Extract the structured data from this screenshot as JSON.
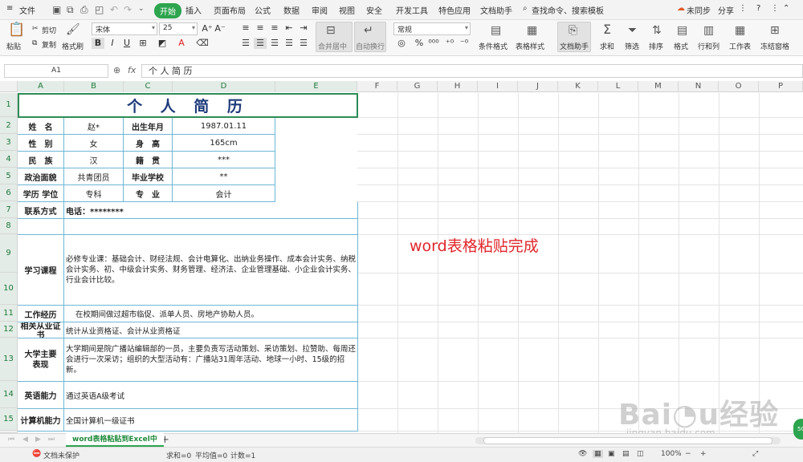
{
  "menu": {
    "file": "文件",
    "start": "开始",
    "tabs": [
      "插入",
      "页面布局",
      "公式",
      "数据",
      "审阅",
      "视图",
      "安全",
      "开发工具",
      "特色应用",
      "文档助手"
    ],
    "search": "查找命令、搜索模板",
    "sync": "未同步",
    "share": "分享"
  },
  "toolbar": {
    "paste": "粘贴",
    "cut": "剪切",
    "copy": "复制",
    "format_painter": "格式刷",
    "font": "宋体",
    "size": "25",
    "merge": "合并居中",
    "wrap": "自动换行",
    "number_format": "常规",
    "cond_format": "条件格式",
    "table_style": "表格样式",
    "doc_helper": "文档助手",
    "sum": "求和",
    "filter": "筛选",
    "sort": "排序",
    "format": "格式",
    "row_col": "行和列",
    "worksheet": "工作表",
    "freeze": "冻结窗格"
  },
  "formula": {
    "cell_ref": "A1",
    "fx": "fx",
    "content": "个 人 简 历"
  },
  "columns": [
    "A",
    "B",
    "C",
    "D",
    "E",
    "F",
    "G",
    "H",
    "I",
    "J",
    "K",
    "L",
    "M",
    "N",
    "O",
    "P"
  ],
  "rows": [
    "1",
    "2",
    "3",
    "4",
    "5",
    "6",
    "7",
    "8",
    "9",
    "10",
    "11",
    "12",
    "13",
    "14",
    "15"
  ],
  "resume": {
    "title": "个 人 简 历",
    "name_label": "姓　名",
    "name": "赵*",
    "birth_label": "出生年月",
    "birth": "1987.01.11",
    "gender_label": "性　别",
    "gender": "女",
    "height_label": "身　高",
    "height": "165cm",
    "ethnic_label": "民　族",
    "ethnic": "汉",
    "native_label": "籍　贯",
    "native": "***",
    "political_label": "政治面貌",
    "political": "共青团员",
    "school_label": "毕业学校",
    "school": "**",
    "degree_label": "学历 学位",
    "degree": "专科",
    "major_label": "专　业",
    "major": "会计",
    "contact_label": "联系方式",
    "contact": "电话：********",
    "course_label": "学习课程",
    "course": "必修专业课：基础会计、财经法规、会计电算化、出纳业务操作、成本会计实务、纳税会计实务、初、中级会计实务、财务管理、经济法、企业管理基础、小企业会计实务、行业会计比较。",
    "work_label": "工作经历",
    "work": "在校期间做过超市临促、派单人员、房地产协助人员。",
    "cert_label": "相关从业证书",
    "cert": "统计从业资格证、会计从业资格证",
    "college_label": "大学主要表现",
    "college": "大学期间是院广播站编辑部的一员，主要负责写活动策划、采访策划、拉赞助、每周还会进行一次采访；组织的大型活动有：广播站31周年活动、地球一小时、15级的招新。",
    "english_label": "英语能力",
    "english": "通过英语A级考试",
    "computer_label": "计算机能力",
    "computer": "全国计算机一级证书"
  },
  "annotation": "word表格粘贴完成",
  "sheet_tab": "word表格粘贴到Excel中",
  "status": {
    "protect": "文档未保护",
    "sum": "求和=0",
    "avg": "平均值=0",
    "count": "计数=1",
    "zoom": "100%"
  },
  "watermark": "Baidu经验 jingyan.baidu.com"
}
